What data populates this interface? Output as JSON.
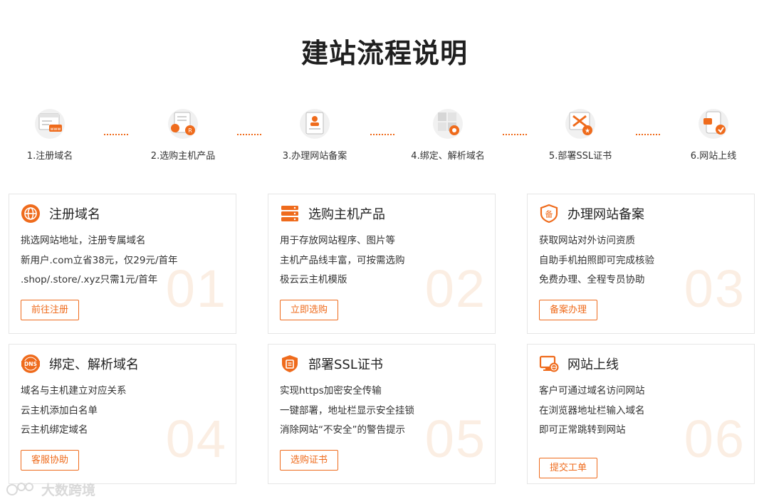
{
  "page": {
    "title": "建站流程说明"
  },
  "steps": [
    {
      "label": "1.注册域名",
      "icon": "domain-browser-icon"
    },
    {
      "label": "2.选购主机产品",
      "icon": "host-document-icon"
    },
    {
      "label": "3.办理网站备案",
      "icon": "id-card-icon"
    },
    {
      "label": "4.绑定、解析域名",
      "icon": "dns-grid-icon"
    },
    {
      "label": "5.部署SSL证书",
      "icon": "ssl-certificate-icon"
    },
    {
      "label": "6.网站上线",
      "icon": "mobile-launch-icon"
    }
  ],
  "cards": [
    {
      "title": "注册域名",
      "lines": [
        "挑选网站地址，注册专属域名",
        "新用户.com立省38元，仅29元/首年",
        ".shop/.store/.xyz只需1元/首年"
      ],
      "button": "前往注册",
      "number": "01"
    },
    {
      "title": "选购主机产品",
      "lines": [
        "用于存放网站程序、图片等",
        "主机产品线丰富，可按需选购",
        "极云云主机模版"
      ],
      "button": "立即选购",
      "number": "02"
    },
    {
      "title": "办理网站备案",
      "lines": [
        "获取网站对外访问资质",
        "自助手机拍照即可完成核验",
        "免费办理、全程专员协助"
      ],
      "button": "备案办理",
      "number": "03"
    },
    {
      "title": "绑定、解析域名",
      "lines": [
        "域名与主机建立对应关系",
        "云主机添加白名单",
        "云主机绑定域名"
      ],
      "button": "客服协助",
      "number": "04"
    },
    {
      "title": "部署SSL证书",
      "lines": [
        "实现https加密安全传输",
        "一键部署，地址栏显示安全挂锁",
        "消除网站“不安全”的警告提示"
      ],
      "button": "选购证书",
      "number": "05"
    },
    {
      "title": "网站上线",
      "lines": [
        "客户可通过域名访问网站",
        "在浏览器地址栏输入域名",
        "即可正常跳转到网站"
      ],
      "button": "提交工单",
      "number": "06"
    }
  ],
  "watermark": {
    "text": "大数跨境"
  },
  "colors": {
    "accent": "#ef6b1c",
    "number_faint": "#fbeee3",
    "border": "#e6e6e6"
  }
}
